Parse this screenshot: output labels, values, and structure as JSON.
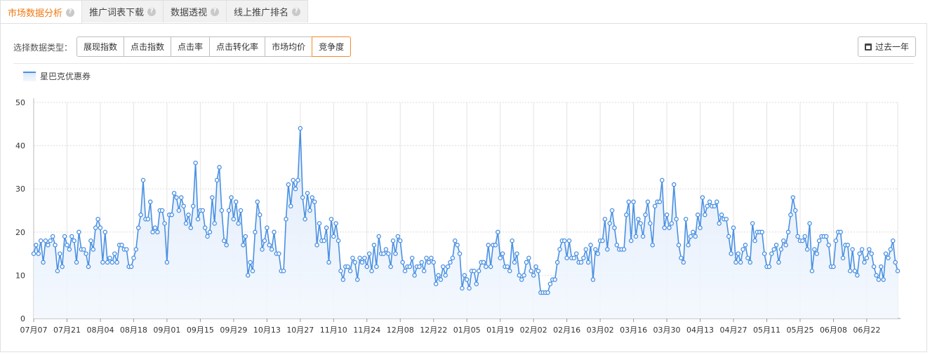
{
  "tabs": [
    {
      "label": "市场数据分析",
      "active": true
    },
    {
      "label": "推广词表下载",
      "active": false
    },
    {
      "label": "数据透视",
      "active": false
    },
    {
      "label": "线上推广排名",
      "active": false
    }
  ],
  "filter": {
    "label": "选择数据类型：",
    "options": [
      "展现指数",
      "点击指数",
      "点击率",
      "点击转化率",
      "市场均价",
      "竞争度"
    ],
    "selected": "竞争度"
  },
  "period_button": {
    "label": "过去一年",
    "icon": "calendar-icon"
  },
  "colors": {
    "accent": "#f27913",
    "line": "#4a90e2",
    "fill": "#dde9fa"
  },
  "chart_data": {
    "type": "line",
    "series": [
      {
        "name": "星巴克优惠券",
        "values": [
          15,
          17,
          15,
          18,
          13,
          18,
          17,
          18,
          19,
          17,
          11,
          15,
          12,
          19,
          17,
          16,
          19,
          18,
          13,
          20,
          16,
          16,
          15,
          12,
          18,
          16,
          21,
          23,
          21,
          13,
          20,
          13,
          14,
          13,
          15,
          13,
          17,
          17,
          16,
          16,
          12,
          12,
          14,
          16,
          21,
          24,
          32,
          23,
          23,
          27,
          20,
          21,
          20,
          25,
          25,
          22,
          13,
          24,
          24,
          29,
          28,
          25,
          28,
          26,
          22,
          24,
          21,
          26,
          36,
          23,
          25,
          25,
          21,
          19,
          20,
          28,
          22,
          32,
          35,
          25,
          18,
          17,
          25,
          28,
          23,
          27,
          22,
          25,
          17,
          19,
          10,
          13,
          11,
          20,
          27,
          24,
          16,
          18,
          21,
          17,
          16,
          20,
          15,
          15,
          11,
          11,
          23,
          31,
          26,
          32,
          30,
          32,
          44,
          28,
          23,
          29,
          25,
          28,
          27,
          17,
          22,
          18,
          18,
          21,
          13,
          23,
          19,
          22,
          18,
          11,
          9,
          12,
          12,
          11,
          14,
          13,
          9,
          14,
          13,
          14,
          12,
          15,
          11,
          17,
          12,
          19,
          15,
          15,
          16,
          15,
          12,
          18,
          15,
          19,
          18,
          13,
          11,
          12,
          12,
          14,
          10,
          12,
          12,
          13,
          11,
          14,
          13,
          14,
          13,
          8,
          10,
          9,
          12,
          10,
          12,
          13,
          14,
          18,
          17,
          15,
          7,
          10,
          9,
          7,
          11,
          11,
          8,
          11,
          13,
          13,
          12,
          17,
          12,
          17,
          17,
          20,
          14,
          15,
          12,
          12,
          11,
          18,
          13,
          15,
          10,
          9,
          10,
          13,
          14,
          11,
          10,
          12,
          11,
          6,
          6,
          6,
          6,
          8,
          9,
          9,
          13,
          16,
          18,
          18,
          14,
          18,
          14,
          14,
          15,
          13,
          13,
          14,
          16,
          13,
          17,
          9,
          16,
          15,
          18,
          18,
          23,
          16,
          22,
          25,
          21,
          17,
          16,
          16,
          16,
          24,
          27,
          18,
          27,
          19,
          23,
          22,
          19,
          24,
          27,
          22,
          17,
          26,
          27,
          27,
          32,
          21,
          24,
          21,
          22,
          31,
          23,
          17,
          14,
          13,
          23,
          17,
          19,
          20,
          19,
          24,
          21,
          28,
          24,
          26,
          27,
          26,
          26,
          27,
          22,
          24,
          23,
          23,
          19,
          15,
          21,
          13,
          15,
          13,
          16,
          17,
          14,
          13,
          22,
          18,
          20,
          20,
          20,
          15,
          12,
          12,
          15,
          16,
          17,
          13,
          16,
          18,
          17,
          20,
          24,
          28,
          25,
          19,
          18,
          18,
          19,
          16,
          22,
          11,
          16,
          15,
          18,
          19,
          19,
          19,
          17,
          12,
          12,
          18,
          20,
          20,
          14,
          17,
          17,
          11,
          16,
          11,
          10,
          15,
          16,
          13,
          14,
          16,
          15,
          12,
          10,
          9,
          12,
          9,
          15,
          14,
          16,
          18,
          13,
          11
        ]
      }
    ],
    "x_ticks": [
      "07月07",
      "07月21",
      "08月04",
      "08月18",
      "09月01",
      "09月15",
      "09月29",
      "10月13",
      "10月27",
      "11月10",
      "11月24",
      "12月08",
      "12月22",
      "01月05",
      "01月19",
      "02月02",
      "02月16",
      "03月02",
      "03月16",
      "03月30",
      "04月13",
      "04月27",
      "05月11",
      "05月25",
      "06月08",
      "06月22"
    ],
    "y_ticks": [
      0,
      10,
      20,
      30,
      40,
      50
    ],
    "ylim": [
      0,
      50
    ],
    "grid": true,
    "legend_position": "top-left"
  }
}
